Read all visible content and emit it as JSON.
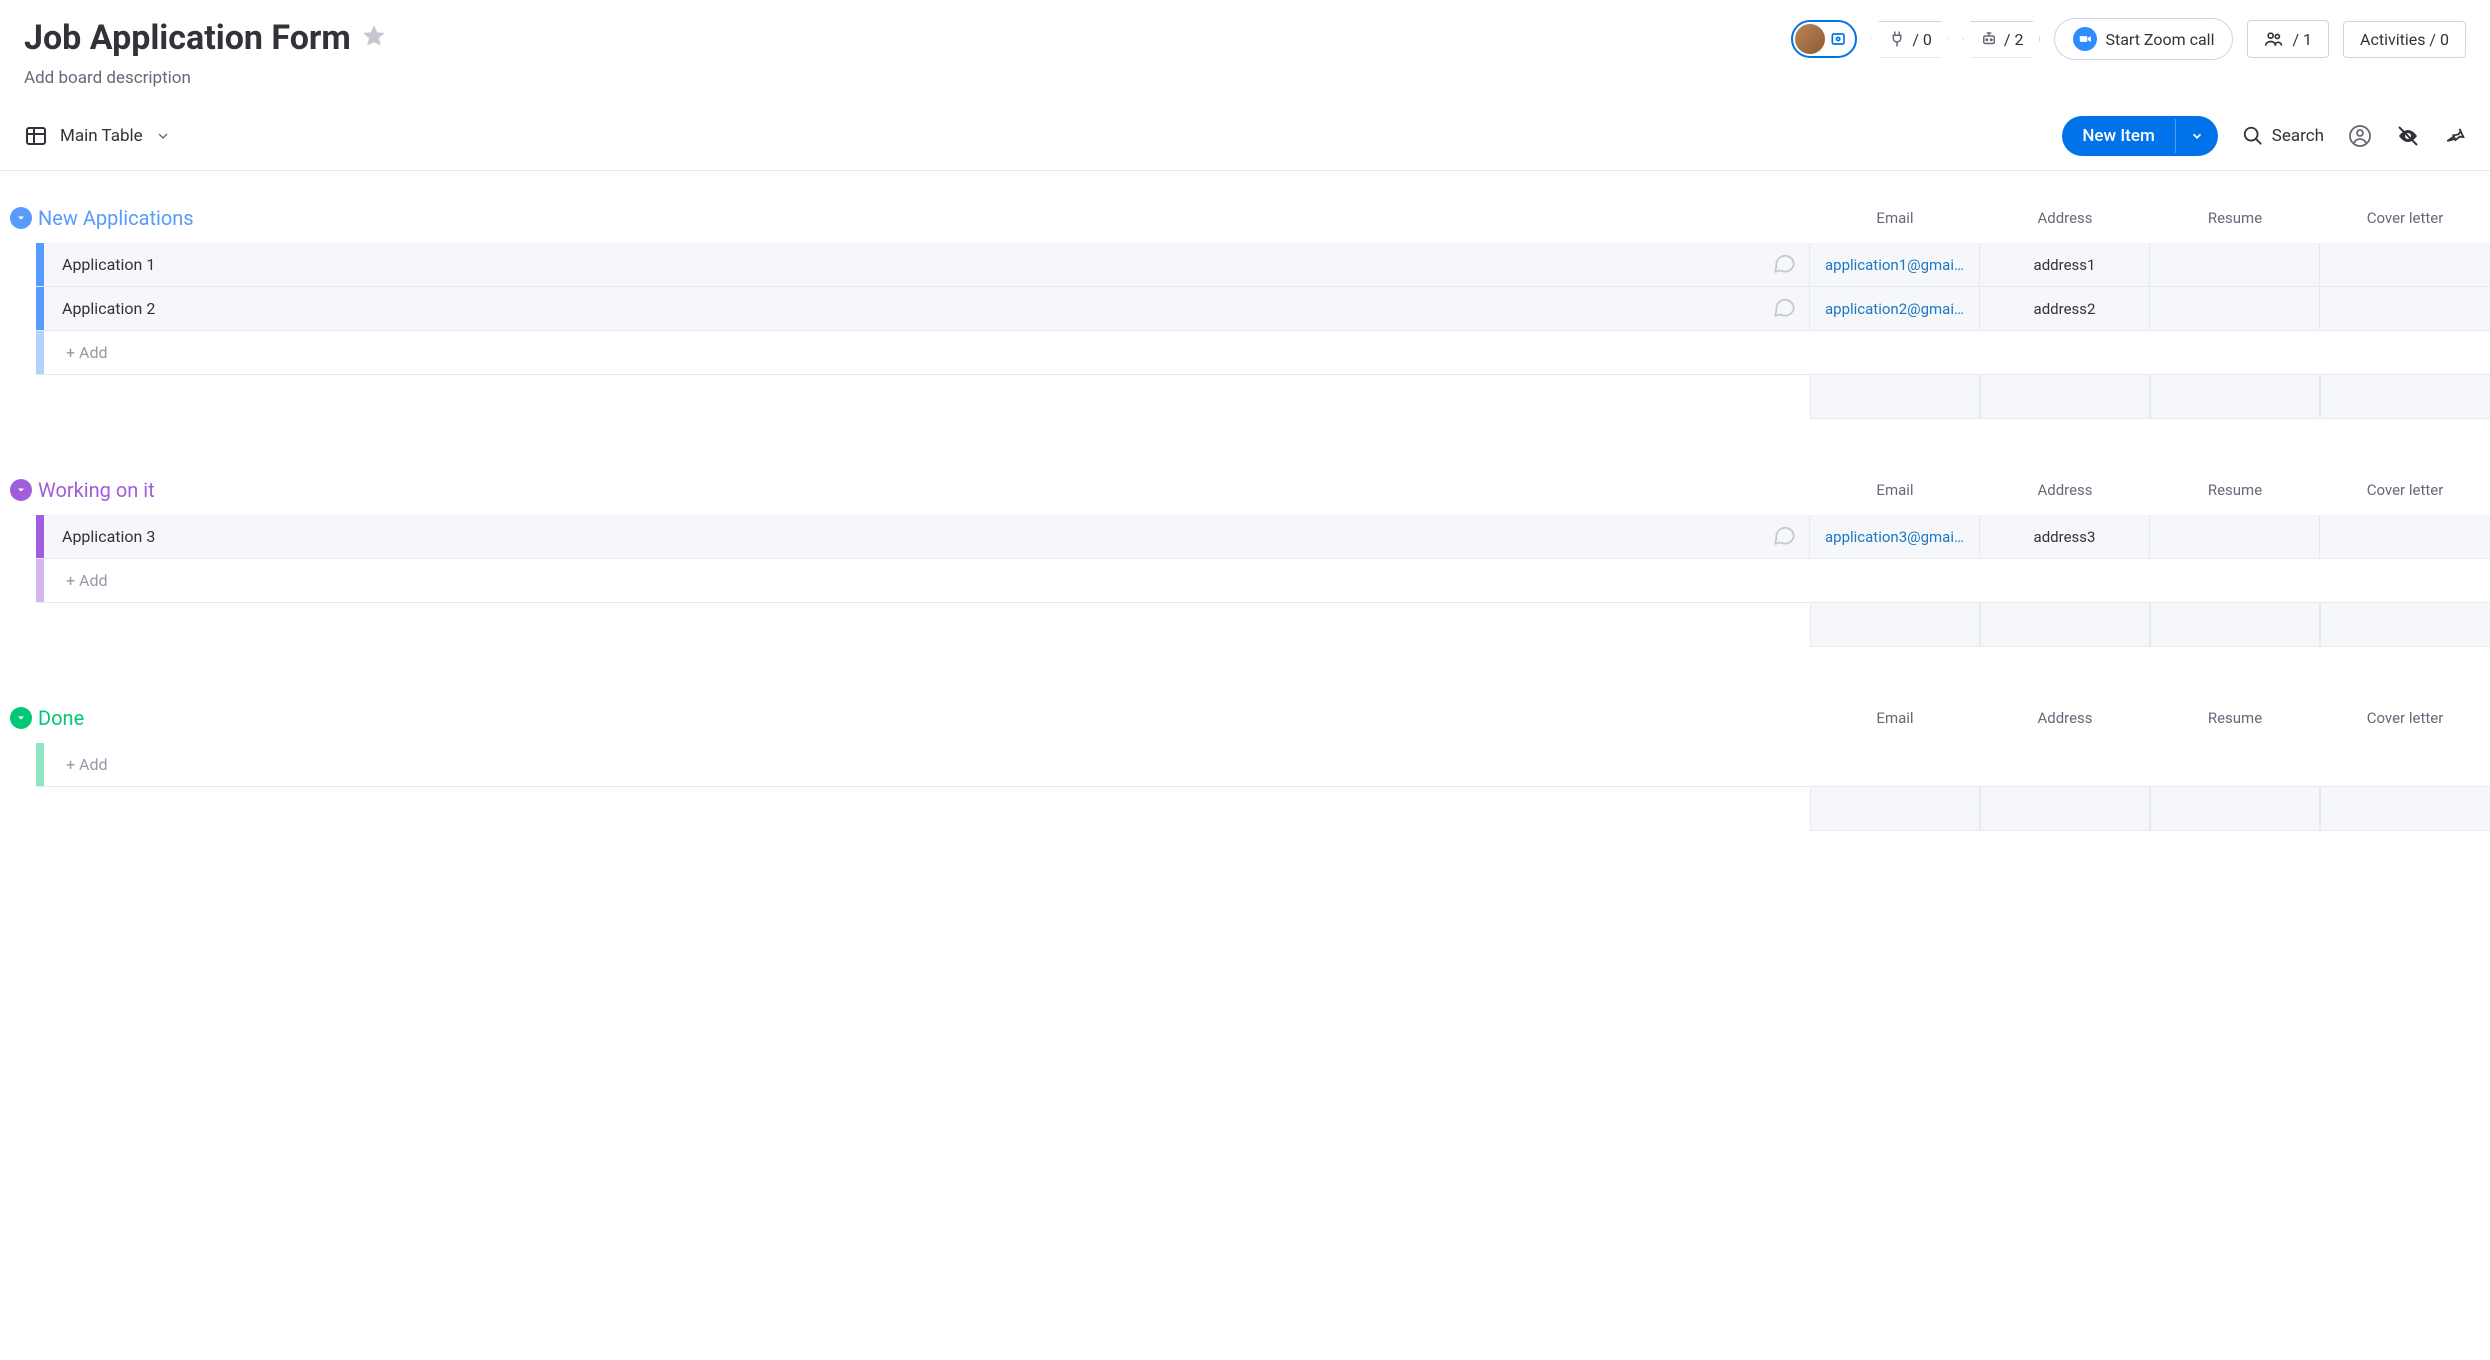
{
  "header": {
    "title": "Job Application Form",
    "description_placeholder": "Add board description",
    "integrations_count": "/ 0",
    "automations_count": "/ 2",
    "zoom_label": "Start Zoom call",
    "members_count": "/ 1",
    "activities_label": "Activities / 0"
  },
  "subheader": {
    "view_label": "Main Table",
    "new_item_label": "New Item",
    "search_label": "Search"
  },
  "columns": [
    "Email",
    "Address",
    "Resume",
    "Cover letter"
  ],
  "groups": [
    {
      "title": "New Applications",
      "color_class": "g-blue",
      "rows": [
        {
          "name": "Application 1",
          "email": "application1@gmai…",
          "address": "address1",
          "resume": "",
          "cover": ""
        },
        {
          "name": "Application 2",
          "email": "application2@gmai…",
          "address": "address2",
          "resume": "",
          "cover": ""
        }
      ],
      "add_label": "+ Add"
    },
    {
      "title": "Working on it",
      "color_class": "g-purple",
      "rows": [
        {
          "name": "Application 3",
          "email": "application3@gmai…",
          "address": "address3",
          "resume": "",
          "cover": ""
        }
      ],
      "add_label": "+ Add"
    },
    {
      "title": "Done",
      "color_class": "g-green",
      "rows": [],
      "add_label": "+ Add"
    }
  ]
}
